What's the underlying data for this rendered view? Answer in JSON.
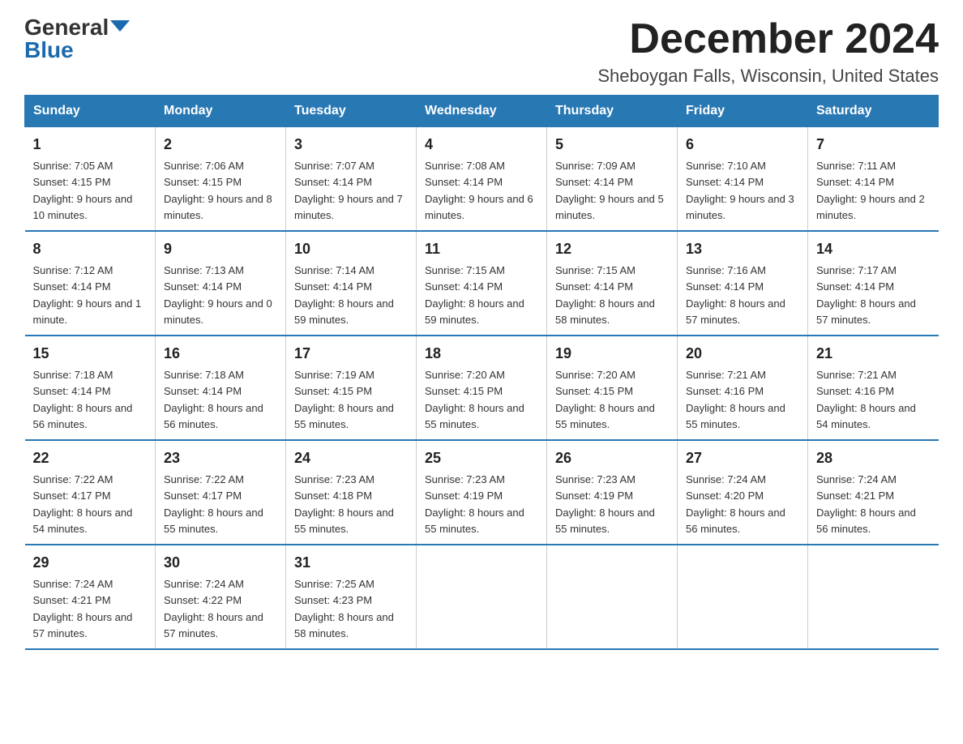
{
  "logo": {
    "general": "General",
    "blue": "Blue"
  },
  "title": "December 2024",
  "location": "Sheboygan Falls, Wisconsin, United States",
  "headers": [
    "Sunday",
    "Monday",
    "Tuesday",
    "Wednesday",
    "Thursday",
    "Friday",
    "Saturday"
  ],
  "weeks": [
    [
      {
        "day": "1",
        "sunrise": "7:05 AM",
        "sunset": "4:15 PM",
        "daylight": "9 hours and 10 minutes."
      },
      {
        "day": "2",
        "sunrise": "7:06 AM",
        "sunset": "4:15 PM",
        "daylight": "9 hours and 8 minutes."
      },
      {
        "day": "3",
        "sunrise": "7:07 AM",
        "sunset": "4:14 PM",
        "daylight": "9 hours and 7 minutes."
      },
      {
        "day": "4",
        "sunrise": "7:08 AM",
        "sunset": "4:14 PM",
        "daylight": "9 hours and 6 minutes."
      },
      {
        "day": "5",
        "sunrise": "7:09 AM",
        "sunset": "4:14 PM",
        "daylight": "9 hours and 5 minutes."
      },
      {
        "day": "6",
        "sunrise": "7:10 AM",
        "sunset": "4:14 PM",
        "daylight": "9 hours and 3 minutes."
      },
      {
        "day": "7",
        "sunrise": "7:11 AM",
        "sunset": "4:14 PM",
        "daylight": "9 hours and 2 minutes."
      }
    ],
    [
      {
        "day": "8",
        "sunrise": "7:12 AM",
        "sunset": "4:14 PM",
        "daylight": "9 hours and 1 minute."
      },
      {
        "day": "9",
        "sunrise": "7:13 AM",
        "sunset": "4:14 PM",
        "daylight": "9 hours and 0 minutes."
      },
      {
        "day": "10",
        "sunrise": "7:14 AM",
        "sunset": "4:14 PM",
        "daylight": "8 hours and 59 minutes."
      },
      {
        "day": "11",
        "sunrise": "7:15 AM",
        "sunset": "4:14 PM",
        "daylight": "8 hours and 59 minutes."
      },
      {
        "day": "12",
        "sunrise": "7:15 AM",
        "sunset": "4:14 PM",
        "daylight": "8 hours and 58 minutes."
      },
      {
        "day": "13",
        "sunrise": "7:16 AM",
        "sunset": "4:14 PM",
        "daylight": "8 hours and 57 minutes."
      },
      {
        "day": "14",
        "sunrise": "7:17 AM",
        "sunset": "4:14 PM",
        "daylight": "8 hours and 57 minutes."
      }
    ],
    [
      {
        "day": "15",
        "sunrise": "7:18 AM",
        "sunset": "4:14 PM",
        "daylight": "8 hours and 56 minutes."
      },
      {
        "day": "16",
        "sunrise": "7:18 AM",
        "sunset": "4:14 PM",
        "daylight": "8 hours and 56 minutes."
      },
      {
        "day": "17",
        "sunrise": "7:19 AM",
        "sunset": "4:15 PM",
        "daylight": "8 hours and 55 minutes."
      },
      {
        "day": "18",
        "sunrise": "7:20 AM",
        "sunset": "4:15 PM",
        "daylight": "8 hours and 55 minutes."
      },
      {
        "day": "19",
        "sunrise": "7:20 AM",
        "sunset": "4:15 PM",
        "daylight": "8 hours and 55 minutes."
      },
      {
        "day": "20",
        "sunrise": "7:21 AM",
        "sunset": "4:16 PM",
        "daylight": "8 hours and 55 minutes."
      },
      {
        "day": "21",
        "sunrise": "7:21 AM",
        "sunset": "4:16 PM",
        "daylight": "8 hours and 54 minutes."
      }
    ],
    [
      {
        "day": "22",
        "sunrise": "7:22 AM",
        "sunset": "4:17 PM",
        "daylight": "8 hours and 54 minutes."
      },
      {
        "day": "23",
        "sunrise": "7:22 AM",
        "sunset": "4:17 PM",
        "daylight": "8 hours and 55 minutes."
      },
      {
        "day": "24",
        "sunrise": "7:23 AM",
        "sunset": "4:18 PM",
        "daylight": "8 hours and 55 minutes."
      },
      {
        "day": "25",
        "sunrise": "7:23 AM",
        "sunset": "4:19 PM",
        "daylight": "8 hours and 55 minutes."
      },
      {
        "day": "26",
        "sunrise": "7:23 AM",
        "sunset": "4:19 PM",
        "daylight": "8 hours and 55 minutes."
      },
      {
        "day": "27",
        "sunrise": "7:24 AM",
        "sunset": "4:20 PM",
        "daylight": "8 hours and 56 minutes."
      },
      {
        "day": "28",
        "sunrise": "7:24 AM",
        "sunset": "4:21 PM",
        "daylight": "8 hours and 56 minutes."
      }
    ],
    [
      {
        "day": "29",
        "sunrise": "7:24 AM",
        "sunset": "4:21 PM",
        "daylight": "8 hours and 57 minutes."
      },
      {
        "day": "30",
        "sunrise": "7:24 AM",
        "sunset": "4:22 PM",
        "daylight": "8 hours and 57 minutes."
      },
      {
        "day": "31",
        "sunrise": "7:25 AM",
        "sunset": "4:23 PM",
        "daylight": "8 hours and 58 minutes."
      },
      null,
      null,
      null,
      null
    ]
  ]
}
